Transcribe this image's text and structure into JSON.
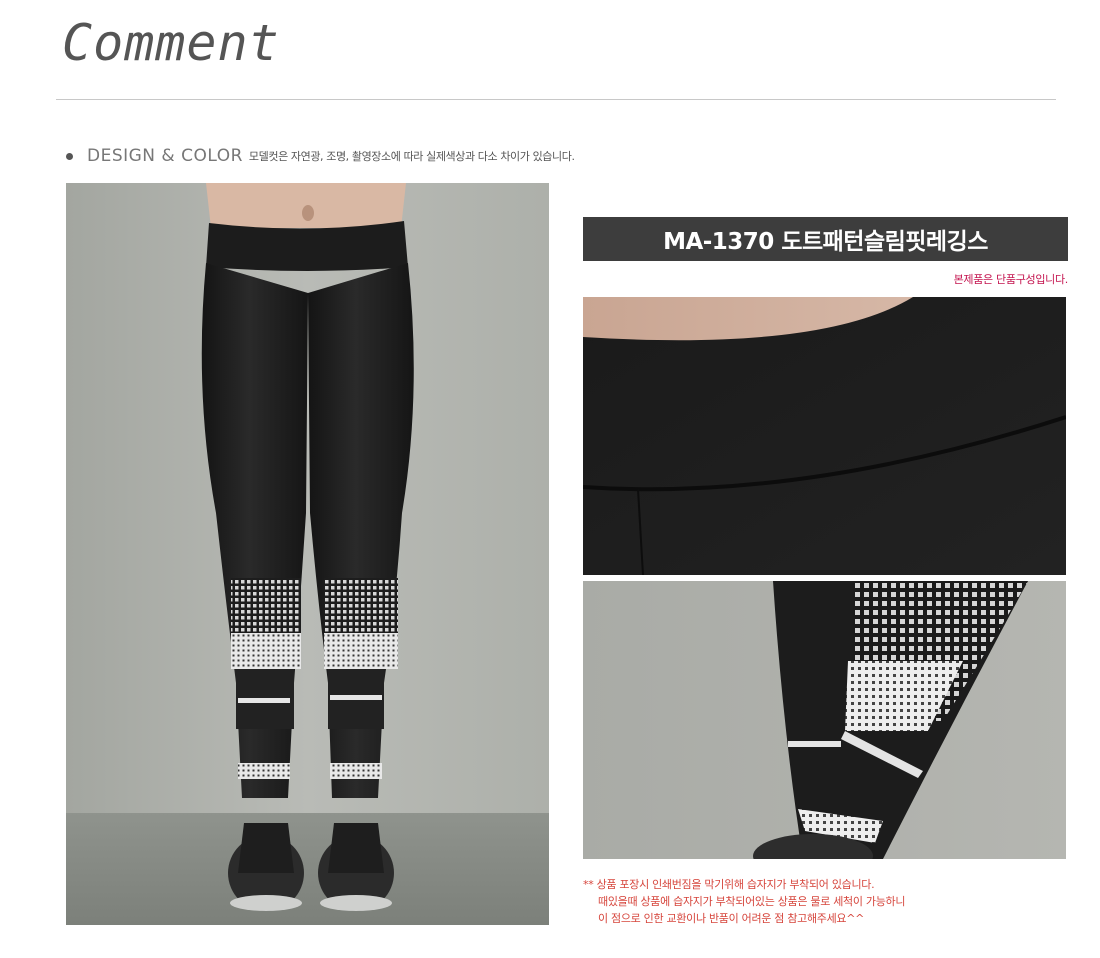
{
  "header": {
    "title": "Comment"
  },
  "design": {
    "label": "DESIGN & COLOR",
    "note": "모델컷은 자연광, 조명, 촬영장소에 따라 실제색상과 다소 차이가 있습니다."
  },
  "product": {
    "title": "MA-1370 도트패턴슬림핏레깅스",
    "single_note": "본제품은 단품구성입니다."
  },
  "notice": {
    "line1": "** 상품 포장시 인쇄번짐을 막기위해 습자지가 부착되어 있습니다.",
    "line2": "때있을때 상품에 습자지가 부착되어있는 상품은 물로 세척이 가능하니",
    "line3": "이 점으로 인한 교환이나 반품이 어려운 점 참고해주세요^^"
  },
  "colors": {
    "banner_bg": "#3d3d3d",
    "accent_pink": "#c4144f",
    "notice_red": "#d6453c"
  }
}
